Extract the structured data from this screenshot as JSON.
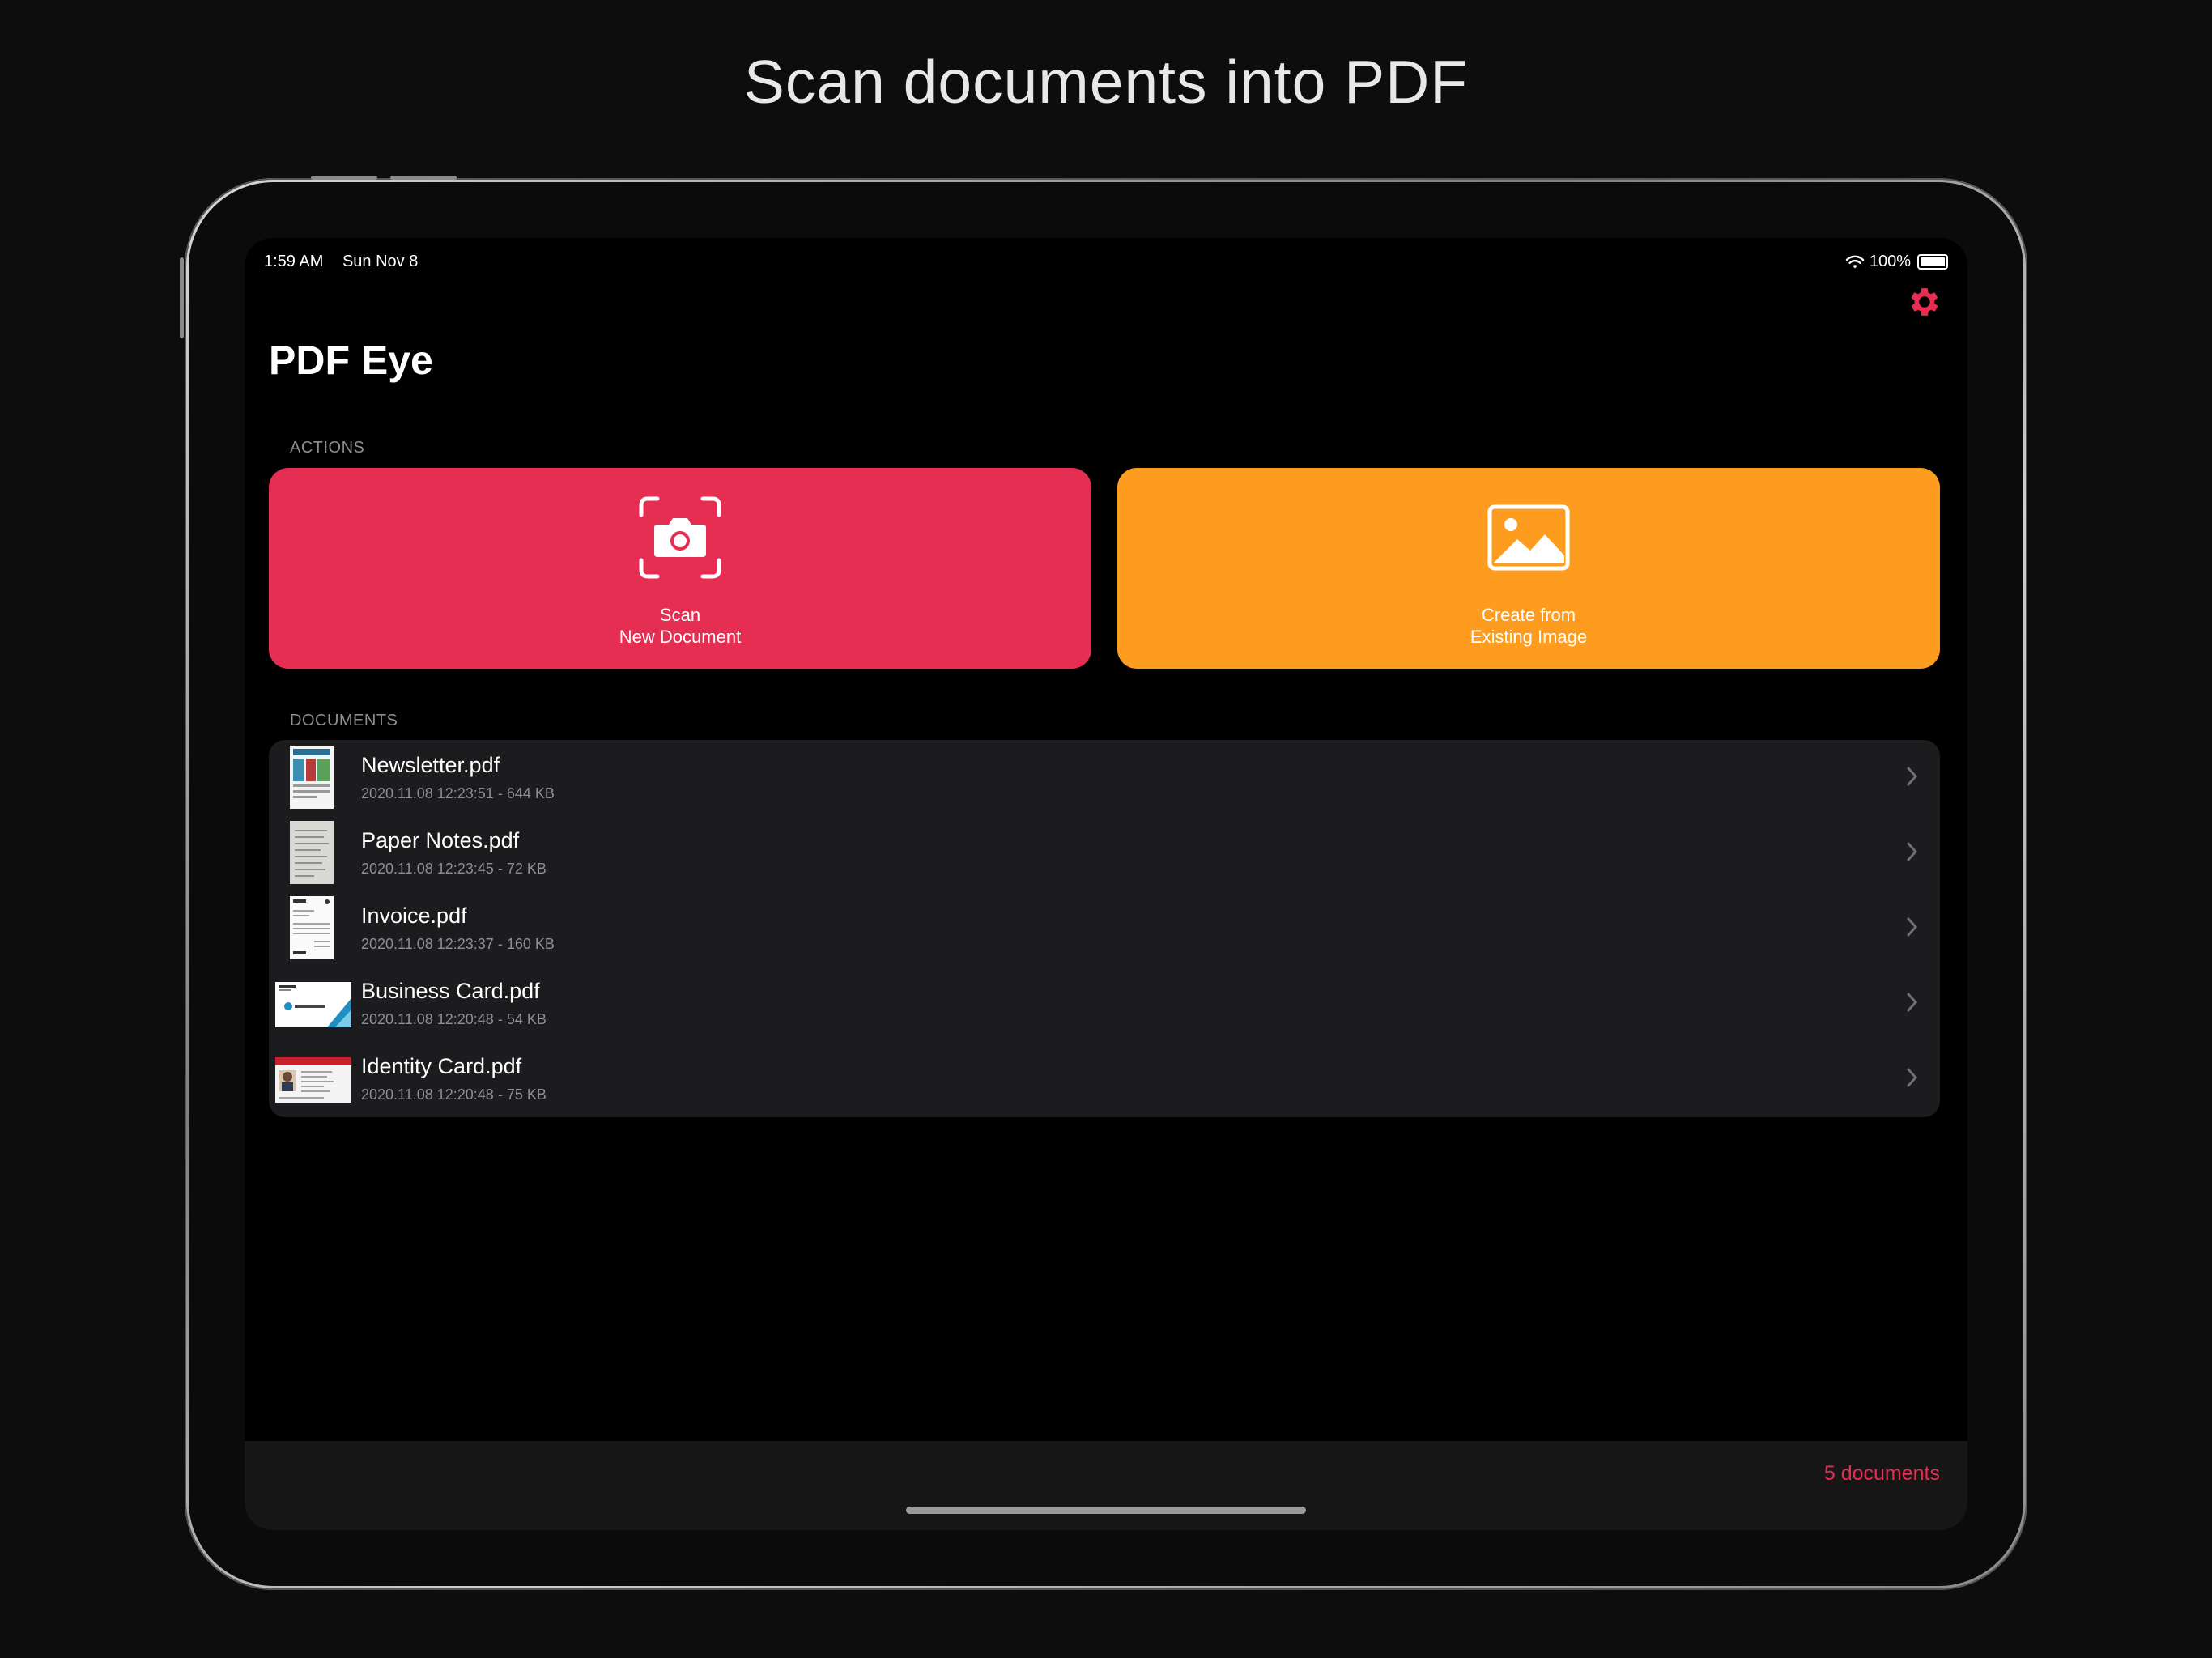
{
  "headline": "Scan documents into PDF",
  "status_bar": {
    "time": "1:59 AM",
    "date": "Sun Nov 8",
    "battery": "100%"
  },
  "app": {
    "title": "PDF Eye",
    "settings_icon": "gear-icon",
    "accent": "#e62d52"
  },
  "actions": {
    "header": "ACTIONS",
    "scan": {
      "line1": "Scan",
      "line2": "New Document",
      "icon": "camera-scan-icon",
      "color": "#e62d52"
    },
    "image": {
      "line1": "Create from",
      "line2": "Existing Image",
      "icon": "photo-icon",
      "color": "#fd9c1f"
    }
  },
  "documents": {
    "header": "DOCUMENTS",
    "items": [
      {
        "name": "Newsletter.pdf",
        "meta": "2020.11.08 12:23:51 - 644 KB"
      },
      {
        "name": "Paper Notes.pdf",
        "meta": "2020.11.08 12:23:45 - 72 KB"
      },
      {
        "name": "Invoice.pdf",
        "meta": "2020.11.08 12:23:37 - 160 KB"
      },
      {
        "name": "Business Card.pdf",
        "meta": "2020.11.08 12:20:48 - 54 KB"
      },
      {
        "name": "Identity Card.pdf",
        "meta": "2020.11.08 12:20:48 - 75 KB"
      }
    ]
  },
  "footer": {
    "count": "5 documents"
  }
}
